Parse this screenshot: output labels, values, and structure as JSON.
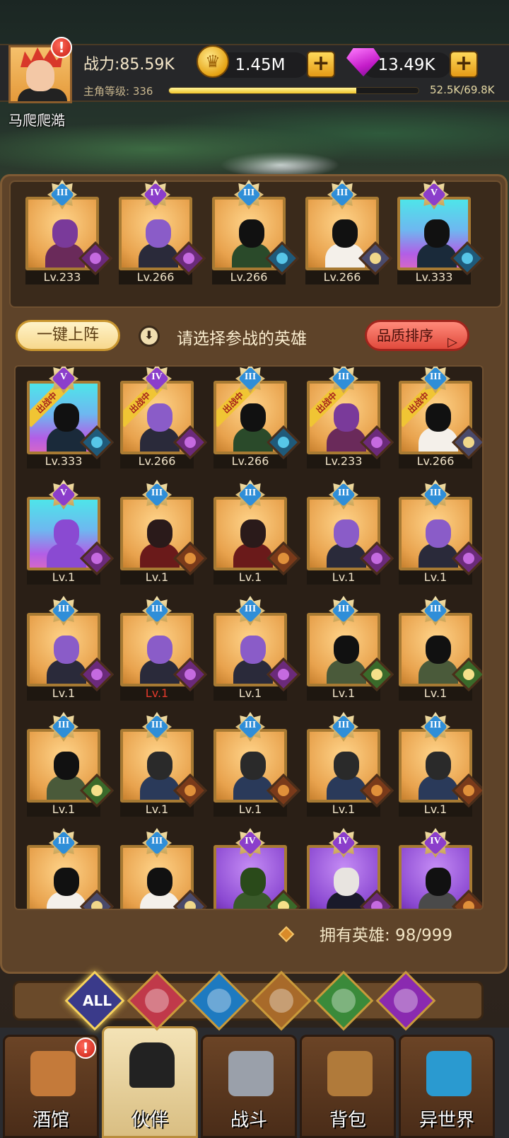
{
  "player": {
    "name": "马爬爬澔",
    "power": "战力:85.59K",
    "level_label": "主角等级: 336",
    "xp_text": "52.5K/69.8K",
    "xp_fraction": 0.752,
    "alert": "!"
  },
  "currency": {
    "gold": "1.45M",
    "gems": "13.49K",
    "plus": "+"
  },
  "lineup": [
    {
      "rank": "III",
      "level": "Lv.233",
      "bg": "orange",
      "faction": "demon",
      "skin": "#6a2a5a",
      "head": "#7a3a9a"
    },
    {
      "rank": "IV",
      "level": "Lv.266",
      "bg": "orange",
      "faction": "demon",
      "skin": "#2a2a3a",
      "head": "#8a5cc8"
    },
    {
      "rank": "III",
      "level": "Lv.266",
      "bg": "orange",
      "faction": "water",
      "skin": "#2a4a2a",
      "head": "#111111"
    },
    {
      "rank": "III",
      "level": "Lv.266",
      "bg": "orange",
      "faction": "holy",
      "skin": "#f4f0ea",
      "head": "#111111"
    },
    {
      "rank": "V",
      "level": "Lv.333",
      "bg": "cyan",
      "faction": "water",
      "skin": "#1a2a3a",
      "head": "#111111"
    }
  ],
  "actions": {
    "quick_deploy": "一键上阵",
    "hint": "请选择参战的英雄",
    "sort": "品质排序",
    "sort_arrow": "▷"
  },
  "deployed_ribbon": "出战中",
  "heroes": [
    {
      "rank": "V",
      "level": "Lv.333",
      "bg": "cyan",
      "faction": "water",
      "deployed": true,
      "skin": "#1a2a3a",
      "head": "#111111"
    },
    {
      "rank": "IV",
      "level": "Lv.266",
      "bg": "orange",
      "faction": "demon",
      "deployed": true,
      "skin": "#2a2a3a",
      "head": "#8a5cc8"
    },
    {
      "rank": "III",
      "level": "Lv.266",
      "bg": "orange",
      "faction": "water",
      "deployed": true,
      "skin": "#2a4a2a",
      "head": "#111111"
    },
    {
      "rank": "III",
      "level": "Lv.233",
      "bg": "orange",
      "faction": "demon",
      "deployed": true,
      "skin": "#6a2a5a",
      "head": "#7a3a9a"
    },
    {
      "rank": "III",
      "level": "Lv.266",
      "bg": "orange",
      "faction": "holy",
      "deployed": true,
      "skin": "#f4f0ea",
      "head": "#111111"
    },
    {
      "rank": "V",
      "level": "Lv.1",
      "bg": "cyan",
      "faction": "demon",
      "skin": "#8a4ad2",
      "head": "#8a4ad2"
    },
    {
      "rank": "III",
      "level": "Lv.1",
      "bg": "orange",
      "faction": "beast",
      "skin": "#6a1a1a",
      "head": "#2a1a1a"
    },
    {
      "rank": "III",
      "level": "Lv.1",
      "bg": "orange",
      "faction": "beast",
      "skin": "#6a1a1a",
      "head": "#2a1a1a"
    },
    {
      "rank": "III",
      "level": "Lv.1",
      "bg": "orange",
      "faction": "demon",
      "skin": "#2a2a3a",
      "head": "#8a5cc8"
    },
    {
      "rank": "III",
      "level": "Lv.1",
      "bg": "orange",
      "faction": "demon",
      "skin": "#2a2a3a",
      "head": "#8a5cc8"
    },
    {
      "rank": "III",
      "level": "Lv.1",
      "bg": "orange",
      "faction": "demon",
      "skin": "#2a2a3a",
      "head": "#8a5cc8"
    },
    {
      "rank": "III",
      "level": "Lv.1",
      "bg": "orange",
      "faction": "demon",
      "skin": "#2a2a3a",
      "head": "#8a5cc8",
      "red": true
    },
    {
      "rank": "III",
      "level": "Lv.1",
      "bg": "orange",
      "faction": "demon",
      "skin": "#2a2a3a",
      "head": "#8a5cc8"
    },
    {
      "rank": "III",
      "level": "Lv.1",
      "bg": "orange",
      "faction": "elf",
      "skin": "#4a5a3a",
      "head": "#111111"
    },
    {
      "rank": "III",
      "level": "Lv.1",
      "bg": "orange",
      "faction": "elf",
      "skin": "#4a5a3a",
      "head": "#111111"
    },
    {
      "rank": "III",
      "level": "Lv.1",
      "bg": "orange",
      "faction": "elf",
      "skin": "#4a5a3a",
      "head": "#111111"
    },
    {
      "rank": "III",
      "level": "Lv.1",
      "bg": "orange",
      "faction": "beast",
      "skin": "#2a3a5a",
      "head": "#2a2a2a"
    },
    {
      "rank": "III",
      "level": "Lv.1",
      "bg": "orange",
      "faction": "beast",
      "skin": "#2a3a5a",
      "head": "#2a2a2a"
    },
    {
      "rank": "III",
      "level": "Lv.1",
      "bg": "orange",
      "faction": "beast",
      "skin": "#2a3a5a",
      "head": "#2a2a2a"
    },
    {
      "rank": "III",
      "level": "Lv.1",
      "bg": "orange",
      "faction": "beast",
      "skin": "#2a3a5a",
      "head": "#2a2a2a"
    },
    {
      "rank": "III",
      "level": "",
      "bg": "orange",
      "faction": "holy",
      "skin": "#f4f0ea",
      "head": "#111111"
    },
    {
      "rank": "III",
      "level": "",
      "bg": "orange",
      "faction": "holy",
      "skin": "#f4f0ea",
      "head": "#111111"
    },
    {
      "rank": "IV",
      "level": "",
      "bg": "purple",
      "faction": "elf",
      "skin": "#3a5a2a",
      "head": "#2a4a1a"
    },
    {
      "rank": "IV",
      "level": "",
      "bg": "purple",
      "faction": "demon",
      "skin": "#1a1a2a",
      "head": "#e8e4e0"
    },
    {
      "rank": "IV",
      "level": "",
      "bg": "purple",
      "faction": "beast",
      "skin": "#4a4a4a",
      "head": "#111111"
    }
  ],
  "hero_count": "拥有英雄: 98/999",
  "filters": [
    {
      "label": "ALL",
      "icon": "all-filter",
      "color": "#3a3a8a"
    },
    {
      "label": "",
      "icon": "holy-faction-icon",
      "color": "#c0394a"
    },
    {
      "label": "",
      "icon": "water-faction-icon",
      "color": "#1e7ac0"
    },
    {
      "label": "",
      "icon": "beast-faction-icon",
      "color": "#a86a2a"
    },
    {
      "label": "",
      "icon": "elf-faction-icon",
      "color": "#3a8a3a"
    },
    {
      "label": "",
      "icon": "demon-faction-icon",
      "color": "#8a2ab0"
    }
  ],
  "nav": [
    {
      "label": "酒馆",
      "icon": "tavern-icon",
      "alert": "!"
    },
    {
      "label": "伙伴",
      "icon": "partner-icon",
      "active": true
    },
    {
      "label": "战斗",
      "icon": "battle-icon"
    },
    {
      "label": "背包",
      "icon": "backpack-icon"
    },
    {
      "label": "异世界",
      "icon": "portal-icon"
    }
  ]
}
